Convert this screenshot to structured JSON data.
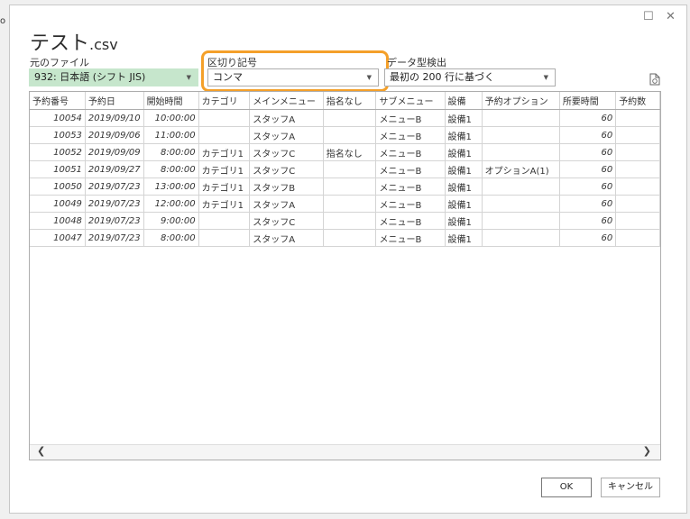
{
  "window": {
    "title": "テスト",
    "title_ext": ".csv",
    "minimize_glyph": "☐",
    "close_glyph": "✕"
  },
  "source_file": {
    "label": "元のファイル",
    "value": "932: 日本語 (シフト JIS)"
  },
  "delimiter": {
    "label": "区切り記号",
    "value": "コンマ"
  },
  "type_detection": {
    "label": "データ型検出",
    "value": "最初の 200 行に基づく"
  },
  "table": {
    "headers": [
      "予約番号",
      "予約日",
      "開始時間",
      "カテゴリ",
      "メインメニュー",
      "指名なし",
      "サブメニュー",
      "設備",
      "予約オプション",
      "所要時間",
      "予約数"
    ],
    "rows": [
      [
        "10054",
        "2019/09/10",
        "10:00:00",
        "",
        "スタッフA",
        "",
        "メニューB",
        "設備1",
        "",
        "60",
        ""
      ],
      [
        "10053",
        "2019/09/06",
        "11:00:00",
        "",
        "スタッフA",
        "",
        "メニューB",
        "設備1",
        "",
        "60",
        ""
      ],
      [
        "10052",
        "2019/09/09",
        "8:00:00",
        "カテゴリ1",
        "スタッフC",
        "指名なし",
        "メニューB",
        "設備1",
        "",
        "60",
        ""
      ],
      [
        "10051",
        "2019/09/27",
        "8:00:00",
        "カテゴリ1",
        "スタッフC",
        "",
        "メニューB",
        "設備1",
        "オプションA(1)",
        "60",
        ""
      ],
      [
        "10050",
        "2019/07/23",
        "13:00:00",
        "カテゴリ1",
        "スタッフB",
        "",
        "メニューB",
        "設備1",
        "",
        "60",
        ""
      ],
      [
        "10049",
        "2019/07/23",
        "12:00:00",
        "カテゴリ1",
        "スタッフA",
        "",
        "メニューB",
        "設備1",
        "",
        "60",
        ""
      ],
      [
        "10048",
        "2019/07/23",
        "9:00:00",
        "",
        "スタッフC",
        "",
        "メニューB",
        "設備1",
        "",
        "60",
        ""
      ],
      [
        "10047",
        "2019/07/23",
        "8:00:00",
        "",
        "スタッフA",
        "",
        "メニューB",
        "設備1",
        "",
        "60",
        ""
      ]
    ]
  },
  "buttons": {
    "ok": "OK",
    "cancel": "キャンセル"
  },
  "colors": {
    "highlight": "#f4a02a",
    "source_file_bg": "#c6e6cc"
  }
}
